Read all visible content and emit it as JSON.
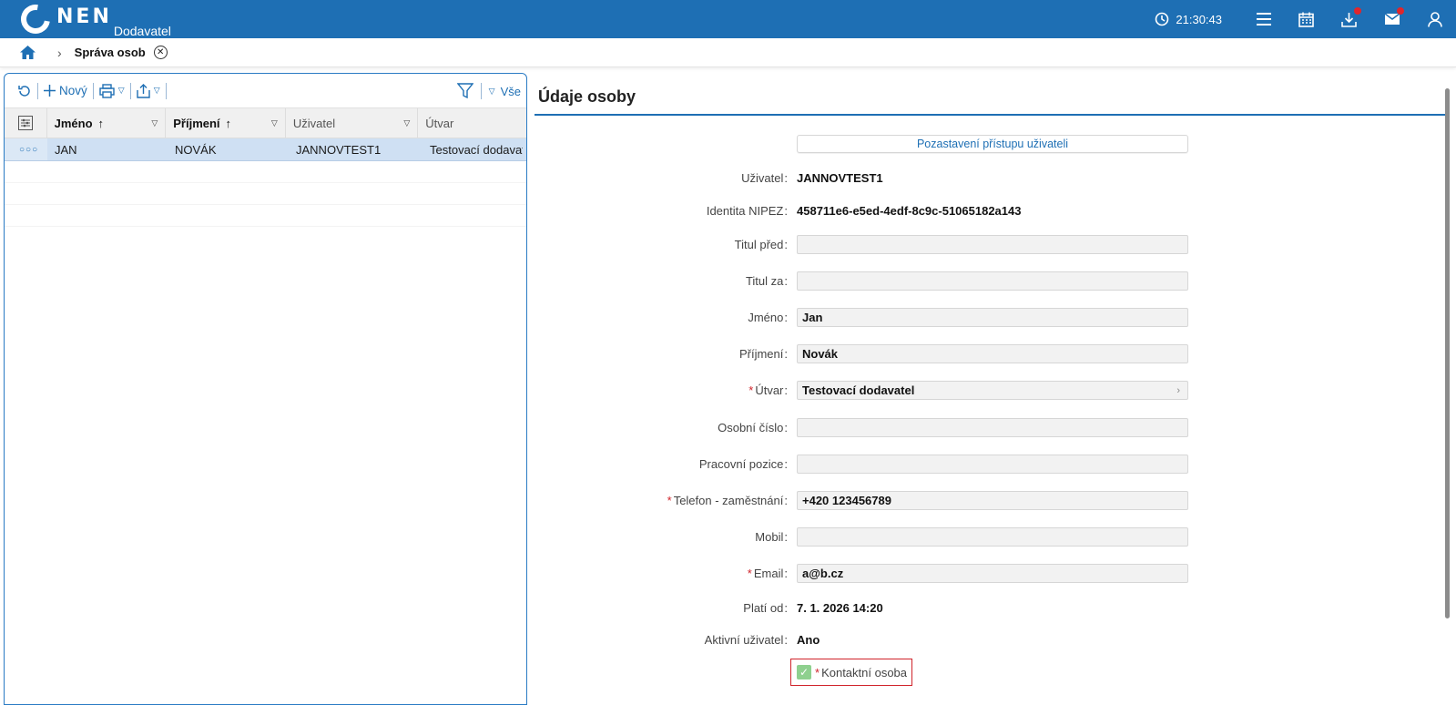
{
  "header": {
    "logo_text": "NEN",
    "logo_sub": "Dodavatel",
    "time": "21:30:43",
    "icons": [
      "clock-icon",
      "menu-icon",
      "calendar-icon",
      "download-icon",
      "mail-icon",
      "user-icon"
    ]
  },
  "breadcrumb": {
    "title": "Správa osob"
  },
  "toolbar": {
    "new_label": "Nový",
    "filter_label": "Vše"
  },
  "grid": {
    "columns": [
      {
        "label": "Jméno",
        "sorted": true
      },
      {
        "label": "Příjmení",
        "sorted": true
      },
      {
        "label": "Uživatel",
        "sorted": false
      },
      {
        "label": "Útvar",
        "sorted": false
      }
    ],
    "rows": [
      {
        "jmeno": "JAN",
        "prijmeni": "NOVÁK",
        "uzivatel": "JANNOVTEST1",
        "utvar": "Testovací dodavatel"
      }
    ]
  },
  "detail": {
    "title": "Údaje osoby",
    "suspend_button": "Pozastavení přístupu uživateli",
    "fields": {
      "uzivatel": {
        "label": "Uživatel",
        "value": "JANNOVTEST1"
      },
      "identita": {
        "label": "Identita NIPEZ",
        "value": "458711e6-e5ed-4edf-8c9c-51065182a143"
      },
      "titul_pred": {
        "label": "Titul před",
        "value": ""
      },
      "titul_za": {
        "label": "Titul za",
        "value": ""
      },
      "jmeno": {
        "label": "Jméno",
        "value": "Jan"
      },
      "prijmeni": {
        "label": "Příjmení",
        "value": "Novák"
      },
      "utvar": {
        "label": "Útvar",
        "value": "Testovací dodavatel"
      },
      "osobni_cislo": {
        "label": "Osobní číslo",
        "value": ""
      },
      "pracovni_pozice": {
        "label": "Pracovní pozice",
        "value": ""
      },
      "telefon": {
        "label": "Telefon - zaměstnání",
        "value": "+420 123456789"
      },
      "mobil": {
        "label": "Mobil",
        "value": ""
      },
      "email": {
        "label": "Email",
        "value": "a@b.cz"
      },
      "plati_od": {
        "label": "Platí od",
        "value": "7. 1. 2026 14:20"
      },
      "aktivni": {
        "label": "Aktivní uživatel",
        "value": "Ano"
      }
    },
    "contact_checkbox": {
      "label": "Kontaktní osoba",
      "checked": true
    }
  }
}
